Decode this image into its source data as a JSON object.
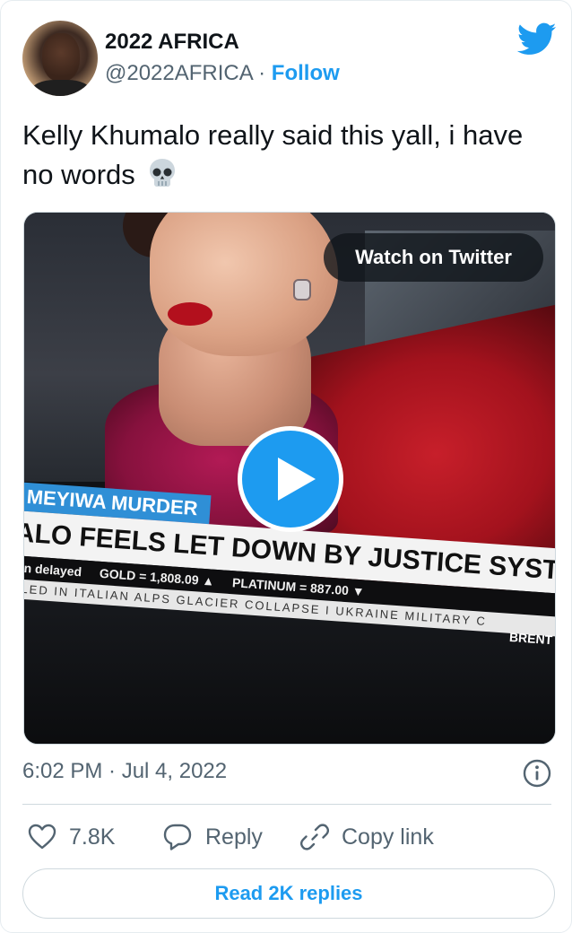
{
  "author": {
    "display_name": "2022 AFRICA",
    "handle": "@2022AFRICA",
    "separator": "·",
    "follow_label": "Follow"
  },
  "tweet": {
    "text": "Kelly Khumalo really said this yall, i have no words",
    "emoji_icon": "skull-icon"
  },
  "media": {
    "watch_label": "Watch on Twitter",
    "play_icon": "play-icon",
    "lower_third_label": "MEYIWA MURDER",
    "headline": "ALO FEELS LET DOWN BY JUSTICE SYSTE",
    "market_items": [
      "min delayed",
      "GOLD = 1,808.09 ▲",
      "PLATINUM = 887.00 ▼"
    ],
    "crawl_text": "ILLED IN ITALIAN ALPS GLACIER COLLAPSE  I  UKRAINE MILITARY C",
    "brent_label": "BRENT"
  },
  "meta": {
    "timestamp": "6:02 PM · Jul 4, 2022",
    "info_icon": "info-icon"
  },
  "actions": {
    "like_count": "7.8K",
    "reply_label": "Reply",
    "copy_link_label": "Copy link"
  },
  "read_replies_label": "Read 2K replies",
  "colors": {
    "accent": "#1d9bf0",
    "text_primary": "#0f1419",
    "text_secondary": "#536471",
    "border": "#cfd9de"
  }
}
